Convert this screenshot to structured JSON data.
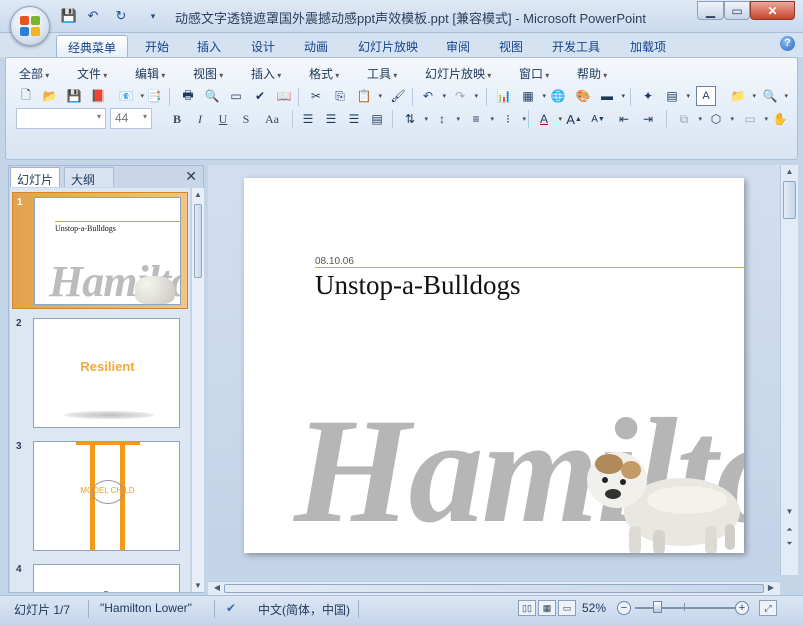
{
  "window": {
    "title": "动感文字透镜遮罩国外震撼动感ppt声效模板.ppt [兼容模式] - Microsoft PowerPoint"
  },
  "ribbon_tabs": [
    "经典菜单",
    "开始",
    "插入",
    "设计",
    "动画",
    "幻灯片放映",
    "审阅",
    "视图",
    "开发工具",
    "加载项"
  ],
  "classic_menu": [
    "全部",
    "文件",
    "编辑",
    "视图",
    "插入",
    "格式",
    "工具",
    "幻灯片放映",
    "窗口",
    "帮助"
  ],
  "toolbar": {
    "font_name": "",
    "font_size": "44",
    "format_buttons": [
      "B",
      "I",
      "U",
      "S",
      "Aa"
    ]
  },
  "panel": {
    "tabs": [
      "幻灯片",
      "大纲"
    ],
    "close_glyph": "✕",
    "slides": [
      {
        "number": "1",
        "title": "Unstop-a-Bulldogs",
        "watermark": "Hamilton"
      },
      {
        "number": "2",
        "title": "Resilient"
      },
      {
        "number": "3",
        "title": "MODEL CHILD"
      },
      {
        "number": "4"
      }
    ]
  },
  "slide": {
    "date": "08.10.06",
    "title": "Unstop-a-Bulldogs",
    "watermark": "Hamilton"
  },
  "status": {
    "slide_info": "幻灯片 1/7",
    "theme": "\"Hamilton Lower\"",
    "language": "中文(简体，中国)",
    "zoom": "52%",
    "zoom_fraction": 0.52
  },
  "colors": {
    "accent_line": "#a6c33c",
    "selected_thumb": "#e0a24c",
    "watermark_gray": "#b6b6b6",
    "orange": "#f29a1a"
  }
}
